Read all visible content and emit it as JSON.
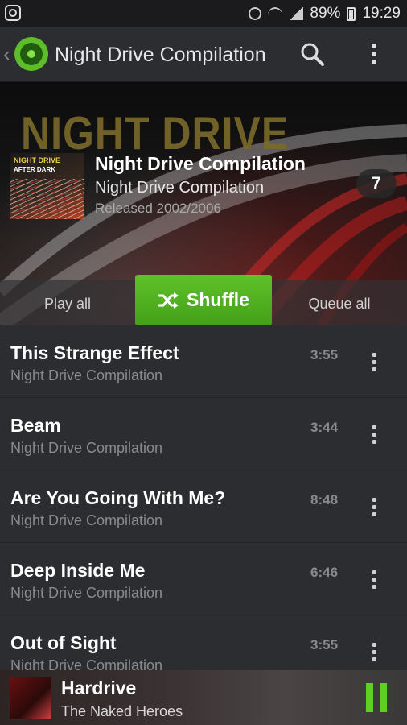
{
  "status_bar": {
    "battery": "89%",
    "time": "19:29"
  },
  "action_bar": {
    "title": "Night Drive Compilation",
    "back_glyph": "‹"
  },
  "header": {
    "art_text": "NIGHT DRIVE",
    "cover_text_1": "NIGHT DRIVE",
    "cover_text_2": "AFTER DARK",
    "album_title": "Night Drive Compilation",
    "album_artist": "Night Drive Compilation",
    "released": "Released 2002/2006",
    "track_count": "7",
    "play_all_label": "Play all",
    "shuffle_label": "Shuffle",
    "queue_all_label": "Queue all",
    "accent_color": "#4fb020"
  },
  "tracks": [
    {
      "title": "This Strange Effect",
      "artist": "Night Drive Compilation",
      "duration": "3:55"
    },
    {
      "title": "Beam",
      "artist": "Night Drive Compilation",
      "duration": "3:44"
    },
    {
      "title": "Are You Going With Me?",
      "artist": "Night Drive Compilation",
      "duration": "8:48"
    },
    {
      "title": "Deep Inside Me",
      "artist": "Night Drive Compilation",
      "duration": "6:46"
    },
    {
      "title": "Out of Sight",
      "artist": "Night Drive Compilation",
      "duration": "3:55"
    }
  ],
  "now_playing": {
    "title": "Hardrive",
    "artist": "The Naked Heroes"
  },
  "icons": {
    "app_logo": "music-disc-icon",
    "search": "search-icon",
    "overflow": "more-vert-icon",
    "shuffle": "shuffle-icon",
    "pause": "pause-icon"
  }
}
